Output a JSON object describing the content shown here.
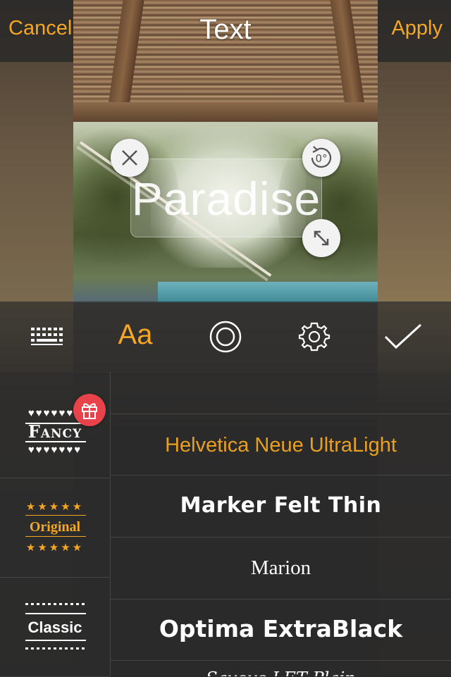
{
  "nav": {
    "cancel_label": "Cancel",
    "title": "Text",
    "apply_label": "Apply"
  },
  "overlay_text": "Paradise",
  "toolbar": {
    "items": [
      {
        "icon": "keyboard-icon"
      },
      {
        "label": "Aa",
        "icon": "font-icon",
        "active": true
      },
      {
        "icon": "style-circle-icon"
      },
      {
        "icon": "gear-icon"
      },
      {
        "icon": "checkmark-icon"
      }
    ]
  },
  "categories": [
    {
      "label": "Fancy",
      "decoration": "♥♥♥♥♥♥♥",
      "badge": "gift-icon"
    },
    {
      "label": "Original",
      "decoration": "★★★★★"
    },
    {
      "label": "Classic"
    }
  ],
  "fonts": [
    "Helvetica Neue UltraLight",
    "Marker Felt Thin",
    "Marion",
    "Optima ExtraBlack",
    "Savoye LET Plain"
  ],
  "colors": {
    "accent": "#f5a623",
    "badge": "#e8424a"
  }
}
